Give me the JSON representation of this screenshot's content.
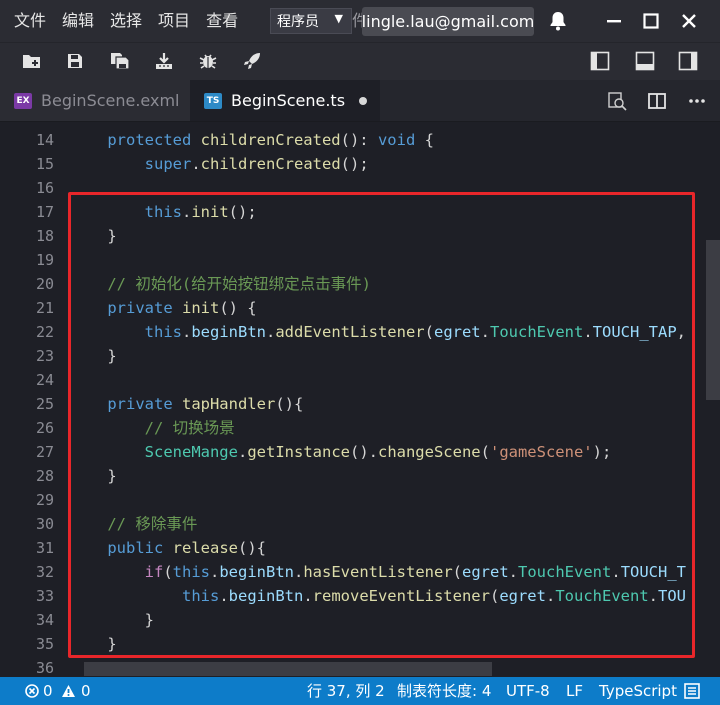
{
  "menubar": {
    "items": [
      "文件",
      "编辑",
      "选择",
      "项目",
      "查看"
    ],
    "hidden_item_fragment": "件",
    "role_select": {
      "value": "程序员"
    },
    "account": "lingle.lau@gmail.com"
  },
  "toolbar": {
    "tools": [
      "new-folder-icon",
      "save-icon",
      "save-all-icon",
      "publish-icon",
      "debug-icon",
      "run-icon"
    ],
    "layout_toggles": [
      "left-panel-icon",
      "bottom-panel-icon",
      "right-panel-icon"
    ]
  },
  "tabs": [
    {
      "label": "BeginScene.exml",
      "icon": "EX",
      "active": false
    },
    {
      "label": "BeginScene.ts",
      "icon": "TS",
      "active": true,
      "modified": true
    }
  ],
  "editor": {
    "lines": [
      {
        "n": "14",
        "segments": [
          [
            "",
            "    "
          ],
          [
            "kw",
            "protected "
          ],
          [
            "fn",
            "childrenCreated"
          ],
          [
            "",
            "(): "
          ],
          [
            "kw",
            "void"
          ],
          [
            "",
            " {"
          ]
        ]
      },
      {
        "n": "15",
        "segments": [
          [
            "",
            "        "
          ],
          [
            "kw",
            "super"
          ],
          [
            "",
            "."
          ],
          [
            "fn",
            "childrenCreated"
          ],
          [
            "",
            "();"
          ]
        ]
      },
      {
        "n": "16",
        "segments": []
      },
      {
        "n": "17",
        "segments": [
          [
            "",
            "        "
          ],
          [
            "kw",
            "this"
          ],
          [
            "",
            "."
          ],
          [
            "fn",
            "init"
          ],
          [
            "",
            "();"
          ]
        ]
      },
      {
        "n": "18",
        "segments": [
          [
            "",
            "    }"
          ]
        ]
      },
      {
        "n": "19",
        "segments": []
      },
      {
        "n": "20",
        "segments": [
          [
            "",
            "    "
          ],
          [
            "cm",
            "// 初始化(给开始按钮绑定点击事件)"
          ]
        ]
      },
      {
        "n": "21",
        "segments": [
          [
            "",
            "    "
          ],
          [
            "kw",
            "private "
          ],
          [
            "fn",
            "init"
          ],
          [
            "",
            "() {"
          ]
        ]
      },
      {
        "n": "22",
        "segments": [
          [
            "",
            "        "
          ],
          [
            "kw",
            "this"
          ],
          [
            "",
            "."
          ],
          [
            "prop",
            "beginBtn"
          ],
          [
            "",
            "."
          ],
          [
            "fn",
            "addEventListener"
          ],
          [
            "",
            "("
          ],
          [
            "prop",
            "egret"
          ],
          [
            "",
            "."
          ],
          [
            "type",
            "TouchEvent"
          ],
          [
            "",
            "."
          ],
          [
            "prop",
            "TOUCH_TAP"
          ],
          [
            "",
            ","
          ]
        ]
      },
      {
        "n": "23",
        "segments": [
          [
            "",
            "    }"
          ]
        ]
      },
      {
        "n": "24",
        "segments": []
      },
      {
        "n": "25",
        "segments": [
          [
            "",
            "    "
          ],
          [
            "kw",
            "private "
          ],
          [
            "fn",
            "tapHandler"
          ],
          [
            "",
            "(){"
          ]
        ]
      },
      {
        "n": "26",
        "segments": [
          [
            "",
            "        "
          ],
          [
            "cm",
            "// 切换场景"
          ]
        ]
      },
      {
        "n": "27",
        "segments": [
          [
            "",
            "        "
          ],
          [
            "type",
            "SceneMange"
          ],
          [
            "",
            "."
          ],
          [
            "fn",
            "getInstance"
          ],
          [
            "",
            "()."
          ],
          [
            "fn",
            "changeScene"
          ],
          [
            "",
            "("
          ],
          [
            "str",
            "'gameScene'"
          ],
          [
            "",
            ");"
          ]
        ]
      },
      {
        "n": "28",
        "segments": [
          [
            "",
            "    }"
          ]
        ]
      },
      {
        "n": "29",
        "segments": []
      },
      {
        "n": "30",
        "segments": [
          [
            "",
            "    "
          ],
          [
            "cm",
            "// 移除事件"
          ]
        ]
      },
      {
        "n": "31",
        "segments": [
          [
            "",
            "    "
          ],
          [
            "kw",
            "public "
          ],
          [
            "fn",
            "release"
          ],
          [
            "",
            "(){"
          ]
        ]
      },
      {
        "n": "32",
        "segments": [
          [
            "",
            "        "
          ],
          [
            "ctrl",
            "if"
          ],
          [
            "",
            "("
          ],
          [
            "kw",
            "this"
          ],
          [
            "",
            "."
          ],
          [
            "prop",
            "beginBtn"
          ],
          [
            "",
            "."
          ],
          [
            "fn",
            "hasEventListener"
          ],
          [
            "",
            "("
          ],
          [
            "prop",
            "egret"
          ],
          [
            "",
            "."
          ],
          [
            "type",
            "TouchEvent"
          ],
          [
            "",
            "."
          ],
          [
            "prop",
            "TOUCH_T"
          ]
        ]
      },
      {
        "n": "33",
        "segments": [
          [
            "",
            "            "
          ],
          [
            "kw",
            "this"
          ],
          [
            "",
            "."
          ],
          [
            "prop",
            "beginBtn"
          ],
          [
            "",
            "."
          ],
          [
            "fn",
            "removeEventListener"
          ],
          [
            "",
            "("
          ],
          [
            "prop",
            "egret"
          ],
          [
            "",
            "."
          ],
          [
            "type",
            "TouchEvent"
          ],
          [
            "",
            "."
          ],
          [
            "prop",
            "TOU"
          ]
        ]
      },
      {
        "n": "34",
        "segments": [
          [
            "",
            "        }"
          ]
        ]
      },
      {
        "n": "35",
        "segments": [
          [
            "",
            "    }"
          ]
        ]
      },
      {
        "n": "36",
        "segments": []
      }
    ]
  },
  "statusbar": {
    "errors": "0",
    "warnings": "0",
    "position": "行 37, 列 2",
    "tab_size": "制表符长度: 4",
    "encoding": "UTF-8",
    "eol": "LF",
    "language": "TypeScript"
  },
  "colors": {
    "highlight_box": "#e8262a",
    "statusbar": "#0d7cc9",
    "editor_bg": "#1e1f26"
  }
}
